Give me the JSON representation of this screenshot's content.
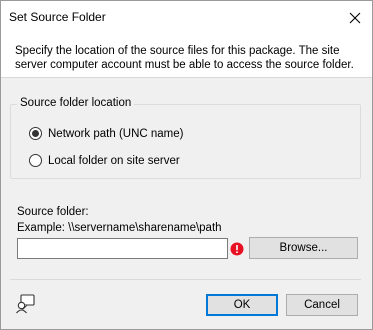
{
  "window": {
    "title": "Set Source Folder"
  },
  "description": "Specify the location of the source files for this package. The site server computer account must be able to access the source folder.",
  "location_group": {
    "label": "Source folder location",
    "options": [
      {
        "label": "Network path (UNC name)",
        "checked": true
      },
      {
        "label": "Local folder on site server",
        "checked": false
      }
    ]
  },
  "source_folder": {
    "label": "Source folder:",
    "example": "Example: \\\\servername\\sharename\\path",
    "value": "",
    "error_icon": "error-icon",
    "browse_label": "Browse..."
  },
  "footer": {
    "help_icon": "help-icon",
    "ok_label": "OK",
    "cancel_label": "Cancel"
  },
  "colors": {
    "accent": "#0078d7",
    "error": "#e81123",
    "dialog_bg": "#f0f0f0"
  }
}
